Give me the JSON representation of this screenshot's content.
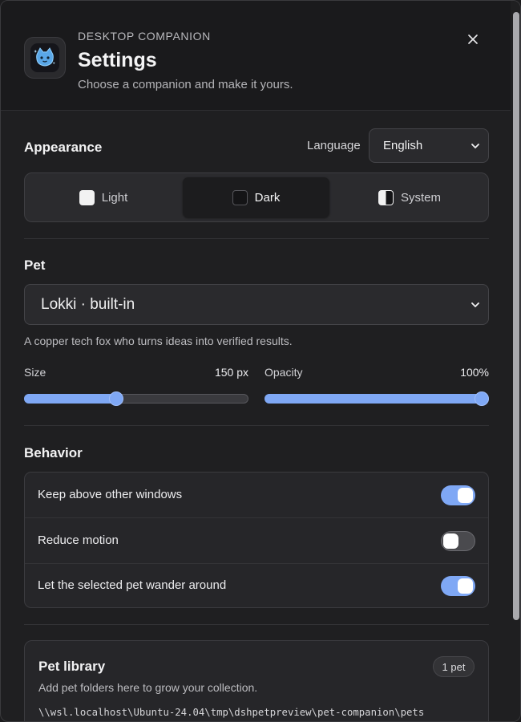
{
  "header": {
    "eyebrow": "DESKTOP COMPANION",
    "title": "Settings",
    "subtitle": "Choose a companion and make it yours.",
    "app_icon": "cat-face-icon",
    "close_icon": "close-icon"
  },
  "appearance": {
    "title": "Appearance",
    "language_label": "Language",
    "language_value": "English",
    "themes": [
      {
        "label": "Light",
        "selected": false,
        "swatch": "#f2f2f2"
      },
      {
        "label": "Dark",
        "selected": true,
        "swatch": "#141416"
      },
      {
        "label": "System",
        "selected": false,
        "swatch": "split"
      }
    ]
  },
  "pet": {
    "title": "Pet",
    "selected": "Lokki · built-in",
    "description": "A copper tech fox who turns ideas into verified results.",
    "size": {
      "label": "Size",
      "display": "150 px",
      "fraction": 0.41
    },
    "opacity": {
      "label": "Opacity",
      "display": "100%",
      "fraction": 1.0
    }
  },
  "behavior": {
    "title": "Behavior",
    "toggles": [
      {
        "label": "Keep above other windows",
        "on": true
      },
      {
        "label": "Reduce motion",
        "on": false
      },
      {
        "label": "Let the selected pet wander around",
        "on": true
      }
    ]
  },
  "library": {
    "title": "Pet library",
    "badge": "1 pet",
    "description": "Add pet folders here to grow your collection.",
    "path": "\\\\wsl.localhost\\Ubuntu-24.04\\tmp\\dshpetpreview\\pet-companion\\pets"
  },
  "colors": {
    "accent": "#7fa8f5",
    "background": "#1f1f21",
    "card": "#262629"
  }
}
